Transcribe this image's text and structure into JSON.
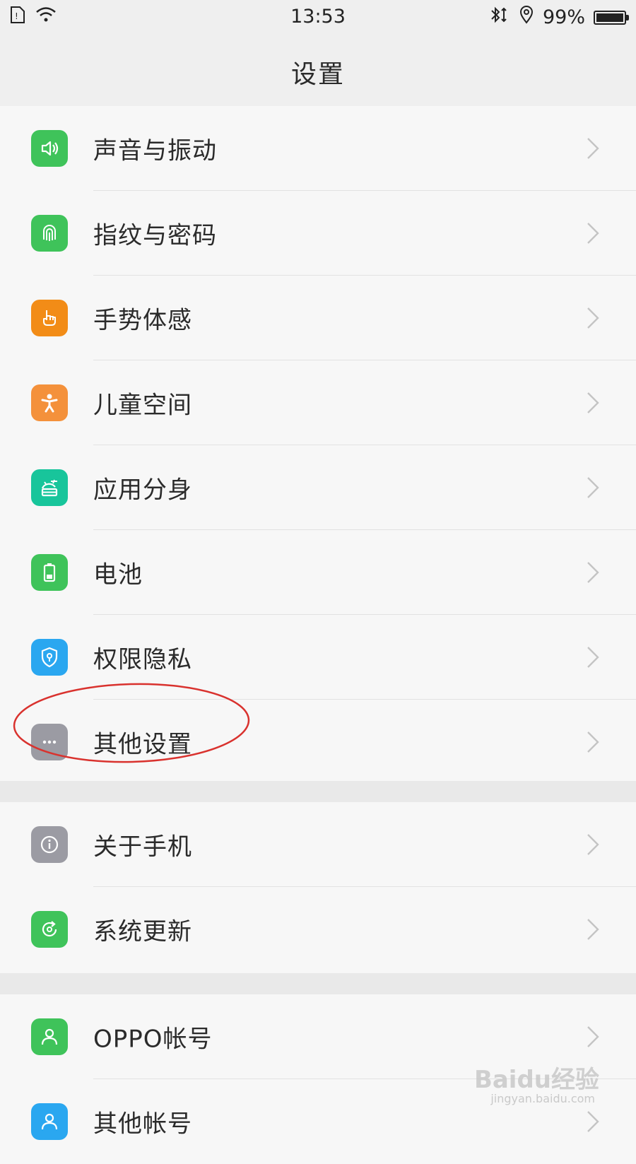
{
  "status": {
    "time": "13:53",
    "battery": "99%",
    "battery_level": 0.99
  },
  "header": {
    "title": "设置"
  },
  "groups": [
    {
      "items": [
        {
          "label": "声音与振动",
          "icon": "speaker-icon",
          "color": "#3fc35a"
        },
        {
          "label": "指纹与密码",
          "icon": "fingerprint-icon",
          "color": "#3fc35a"
        },
        {
          "label": "手势体感",
          "icon": "hand-gesture-icon",
          "color": "#f28c17"
        },
        {
          "label": "儿童空间",
          "icon": "child-icon",
          "color": "#f4913b"
        },
        {
          "label": "应用分身",
          "icon": "android-clone-icon",
          "color": "#18c59b"
        },
        {
          "label": "电池",
          "icon": "battery-icon",
          "color": "#3fc35a"
        },
        {
          "label": "权限隐私",
          "icon": "shield-icon",
          "color": "#2aa7f0"
        },
        {
          "label": "其他设置",
          "icon": "more-icon",
          "color": "#9b9ba3"
        }
      ]
    },
    {
      "items": [
        {
          "label": "关于手机",
          "icon": "info-icon",
          "color": "#9b9ba3"
        },
        {
          "label": "系统更新",
          "icon": "update-icon",
          "color": "#3fc35a"
        }
      ]
    },
    {
      "items": [
        {
          "label": "OPPO帐号",
          "icon": "user-icon",
          "color": "#3fc35a"
        },
        {
          "label": "其他帐号",
          "icon": "user-icon",
          "color": "#2aa7f0"
        }
      ]
    }
  ],
  "watermark": {
    "text": "Baidu经验",
    "sub": "jingyan.baidu.com"
  },
  "colors": {
    "highlight": "#d9322e"
  }
}
